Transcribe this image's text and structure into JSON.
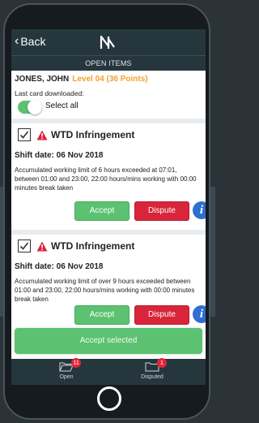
{
  "header": {
    "back_label": "Back",
    "logo_icon": "nc-logo-icon",
    "section_title": "OPEN ITEMS"
  },
  "driver": {
    "name": "JONES, JOHN",
    "level": "Level 04 (36 Points)"
  },
  "last_card_label": "Last card downloaded:",
  "select_all": {
    "label": "Select all",
    "checked": true
  },
  "infringements": [
    {
      "title": "WTD Infringement",
      "shift_date": "Shift date: 06 Nov 2018",
      "description": "Accumulated working limit of 6 hours exceeded at 07:01, between 01:00 and 23:00, 22:00 hours/mins working with 00:00 minutes break taken",
      "accept_label": "Accept",
      "dispute_label": "Dispute",
      "checked": true
    },
    {
      "title": "WTD Infringement",
      "shift_date": "Shift date: 06 Nov 2018",
      "description": "Accumulated working limit of over 9 hours exceeded between 01:00 and 23:00, 22:00 hours/mins working with 00:00 minutes break taken",
      "accept_label": "Accept",
      "dispute_label": "Dispute",
      "checked": true
    }
  ],
  "accept_selected_label": "Accept selected",
  "tabs": [
    {
      "label": "Open",
      "badge": "11",
      "icon": "folder-open-icon"
    },
    {
      "label": "Disputed",
      "badge": "1",
      "icon": "folder-icon"
    }
  ],
  "colors": {
    "accent_green": "#5cc271",
    "danger_red": "#d9253a",
    "info_blue": "#2f6fd0",
    "level_orange": "#f0a030",
    "bar_dark": "#26363d"
  }
}
